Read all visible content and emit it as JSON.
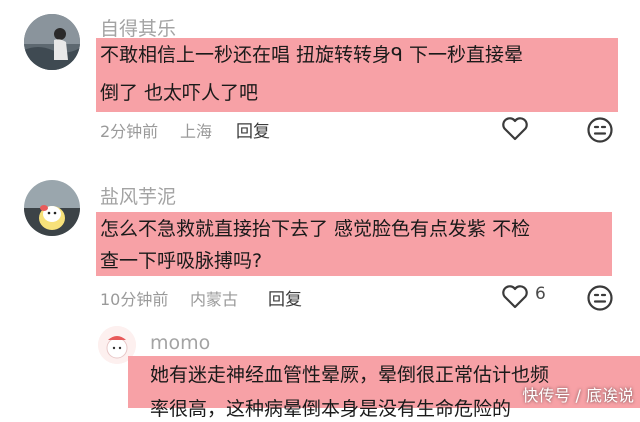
{
  "comments": [
    {
      "username": "自得其乐",
      "lines": [
        "不敢相信上一秒还在唱 扭旋转转身ᑫ  下一秒直接晕",
        "倒了 也太吓人了吧"
      ],
      "time": "2分钟前",
      "location": "上海",
      "reply_label": "回复",
      "like_count": ""
    },
    {
      "username": "盐风芋泥",
      "lines": [
        "怎么不急救就直接抬下去了  感觉脸色有点发紫 不检",
        "查一下呼吸脉搏吗?"
      ],
      "time": "10分钟前",
      "location": "内蒙古",
      "reply_label": "回复",
      "like_count": "6"
    },
    {
      "username": "momo",
      "lines": [
        "她有迷走神经血管性晕厥，晕倒很正常估计也频",
        "率很高，这种病晕倒本身是没有生命危险的"
      ]
    }
  ],
  "watermark": "快传号 / 底诶说",
  "colors": {
    "highlight": "#f7a1a6",
    "username": "#a3a3a3"
  },
  "icons": [
    "heart-icon",
    "emoji-icon"
  ]
}
